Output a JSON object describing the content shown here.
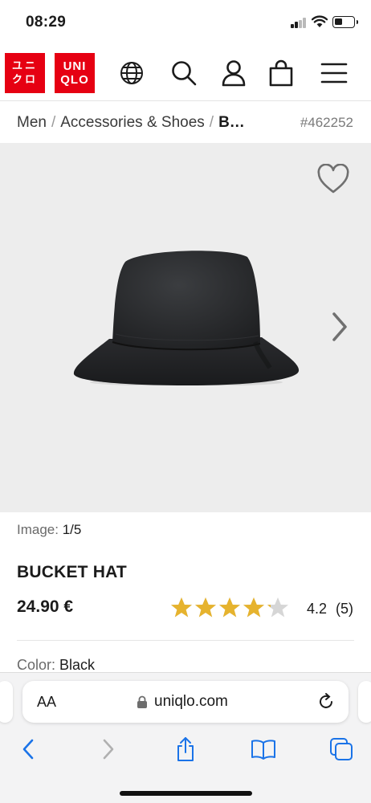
{
  "status_bar": {
    "time": "08:29"
  },
  "header": {
    "logo_katakana": [
      "ユニ",
      "クロ"
    ],
    "logo_latin": [
      "UNI",
      "QLO"
    ],
    "icons": [
      "globe-icon",
      "search-icon",
      "account-icon",
      "cart-icon",
      "menu-icon"
    ]
  },
  "breadcrumb": {
    "items": [
      "Men",
      "Accessories & Shoes",
      "B…"
    ],
    "separator": "/",
    "product_code": "#462252"
  },
  "gallery": {
    "counter_label": "Image:",
    "counter_value": "1/5",
    "background": "#ededed"
  },
  "product": {
    "title": "BUCKET HAT",
    "price": "24.90 €",
    "rating": 4.2,
    "rating_text": "4.2",
    "review_count": "(5)",
    "color_label": "Color:",
    "color_value": "Black"
  },
  "browser": {
    "text_size_label": "AA",
    "url": "uniqlo.com"
  },
  "colors": {
    "brand_red": "#e60012",
    "star_gold": "#e6b32e",
    "star_empty": "#d6d6d6",
    "ios_blue": "#1a73e8"
  }
}
